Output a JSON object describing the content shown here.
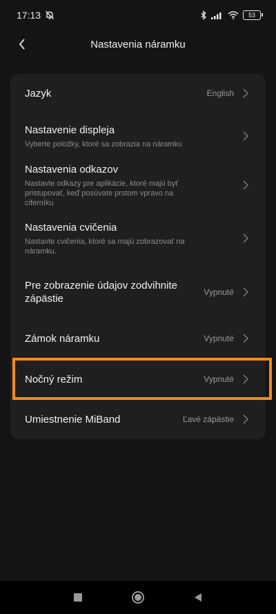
{
  "status_bar": {
    "time": "17:13",
    "battery": "53",
    "icons": [
      "mute-bell-icon",
      "bluetooth-icon",
      "signal-icon",
      "wifi-icon",
      "battery-icon"
    ]
  },
  "header": {
    "title": "Nastavenia náramku",
    "back_icon": "chevron-left-icon"
  },
  "settings": {
    "items": [
      {
        "title": "Jazyk",
        "subtitle": "",
        "value": "English"
      },
      {
        "title": "Nastavenie displeja",
        "subtitle": "Vyberte položky, ktoré sa zobrazia na náramku",
        "value": ""
      },
      {
        "title": "Nastavenia odkazov",
        "subtitle": "Nastavte odkazy pre aplikácie, ktoré majú byť pristupovať, keď posúvate prstom vpravo na ciferníku",
        "value": ""
      },
      {
        "title": "Nastavenia cvičenia",
        "subtitle": "Nastavte cvičenia, ktoré sa majú zobrazovať na náramku.",
        "value": ""
      },
      {
        "title": "Pre zobrazenie údajov zodvihnite zápästie",
        "subtitle": "",
        "value": "Vypnuté"
      },
      {
        "title": "Zámok náramku",
        "subtitle": "",
        "value": "Vypnuté"
      },
      {
        "title": "Nočný režim",
        "subtitle": "",
        "value": "Vypnuté"
      },
      {
        "title": "Umiestnenie MiBand",
        "subtitle": "",
        "value": "Ľavé zápästie"
      }
    ]
  },
  "colors": {
    "background": "#141414",
    "card": "#1f1f1f",
    "highlight": "#f58a1f"
  },
  "nav_bar": {
    "icons": [
      "recent-apps-icon",
      "home-icon",
      "back-triangle-icon"
    ]
  }
}
